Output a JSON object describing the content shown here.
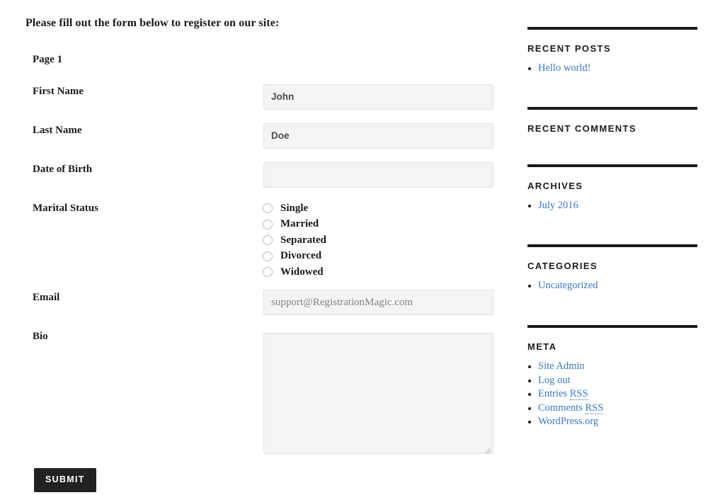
{
  "intro": {
    "text": "Please fill out the form below to register on our site:"
  },
  "form": {
    "page_label": "Page 1",
    "fields": [
      {
        "label": "First Name",
        "type": "text",
        "value": "John",
        "placeholder": ""
      },
      {
        "label": "Last Name",
        "type": "text",
        "value": "Doe",
        "placeholder": ""
      },
      {
        "label": "Date of Birth",
        "type": "text",
        "value": "",
        "placeholder": ""
      },
      {
        "label": "Marital Status",
        "type": "radio",
        "options": [
          {
            "label": "Single",
            "selected": false
          },
          {
            "label": "Married",
            "selected": false
          },
          {
            "label": "Separated",
            "selected": false
          },
          {
            "label": "Divorced",
            "selected": false
          },
          {
            "label": "Widowed",
            "selected": false
          }
        ]
      },
      {
        "label": "Email",
        "type": "text",
        "value": "",
        "placeholder": "support@RegistrationMagic.com"
      },
      {
        "label": "Bio",
        "type": "textarea",
        "value": "",
        "placeholder": ""
      }
    ],
    "submit_label": "SUBMIT"
  },
  "sidebar": {
    "widgets": [
      {
        "title": "RECENT POSTS",
        "items": [
          {
            "label": "Hello world!"
          }
        ]
      },
      {
        "title": "RECENT COMMENTS",
        "items": []
      },
      {
        "title": "ARCHIVES",
        "items": [
          {
            "label": "July 2016"
          }
        ]
      },
      {
        "title": "CATEGORIES",
        "items": [
          {
            "label": "Uncategorized"
          }
        ]
      },
      {
        "title": "META",
        "items": [
          {
            "label": "Site Admin"
          },
          {
            "label": "Log out"
          },
          {
            "label": "Entries RSS",
            "abbr": "RSS"
          },
          {
            "label": "Comments RSS",
            "abbr": "RSS"
          },
          {
            "label": "WordPress.org"
          }
        ]
      }
    ]
  },
  "colors": {
    "link": "#3a78c2",
    "submit_background": "#222222",
    "input_background": "#f4f4f4",
    "input_border": "#e2e2e2",
    "rule": "#1a1a1a"
  }
}
